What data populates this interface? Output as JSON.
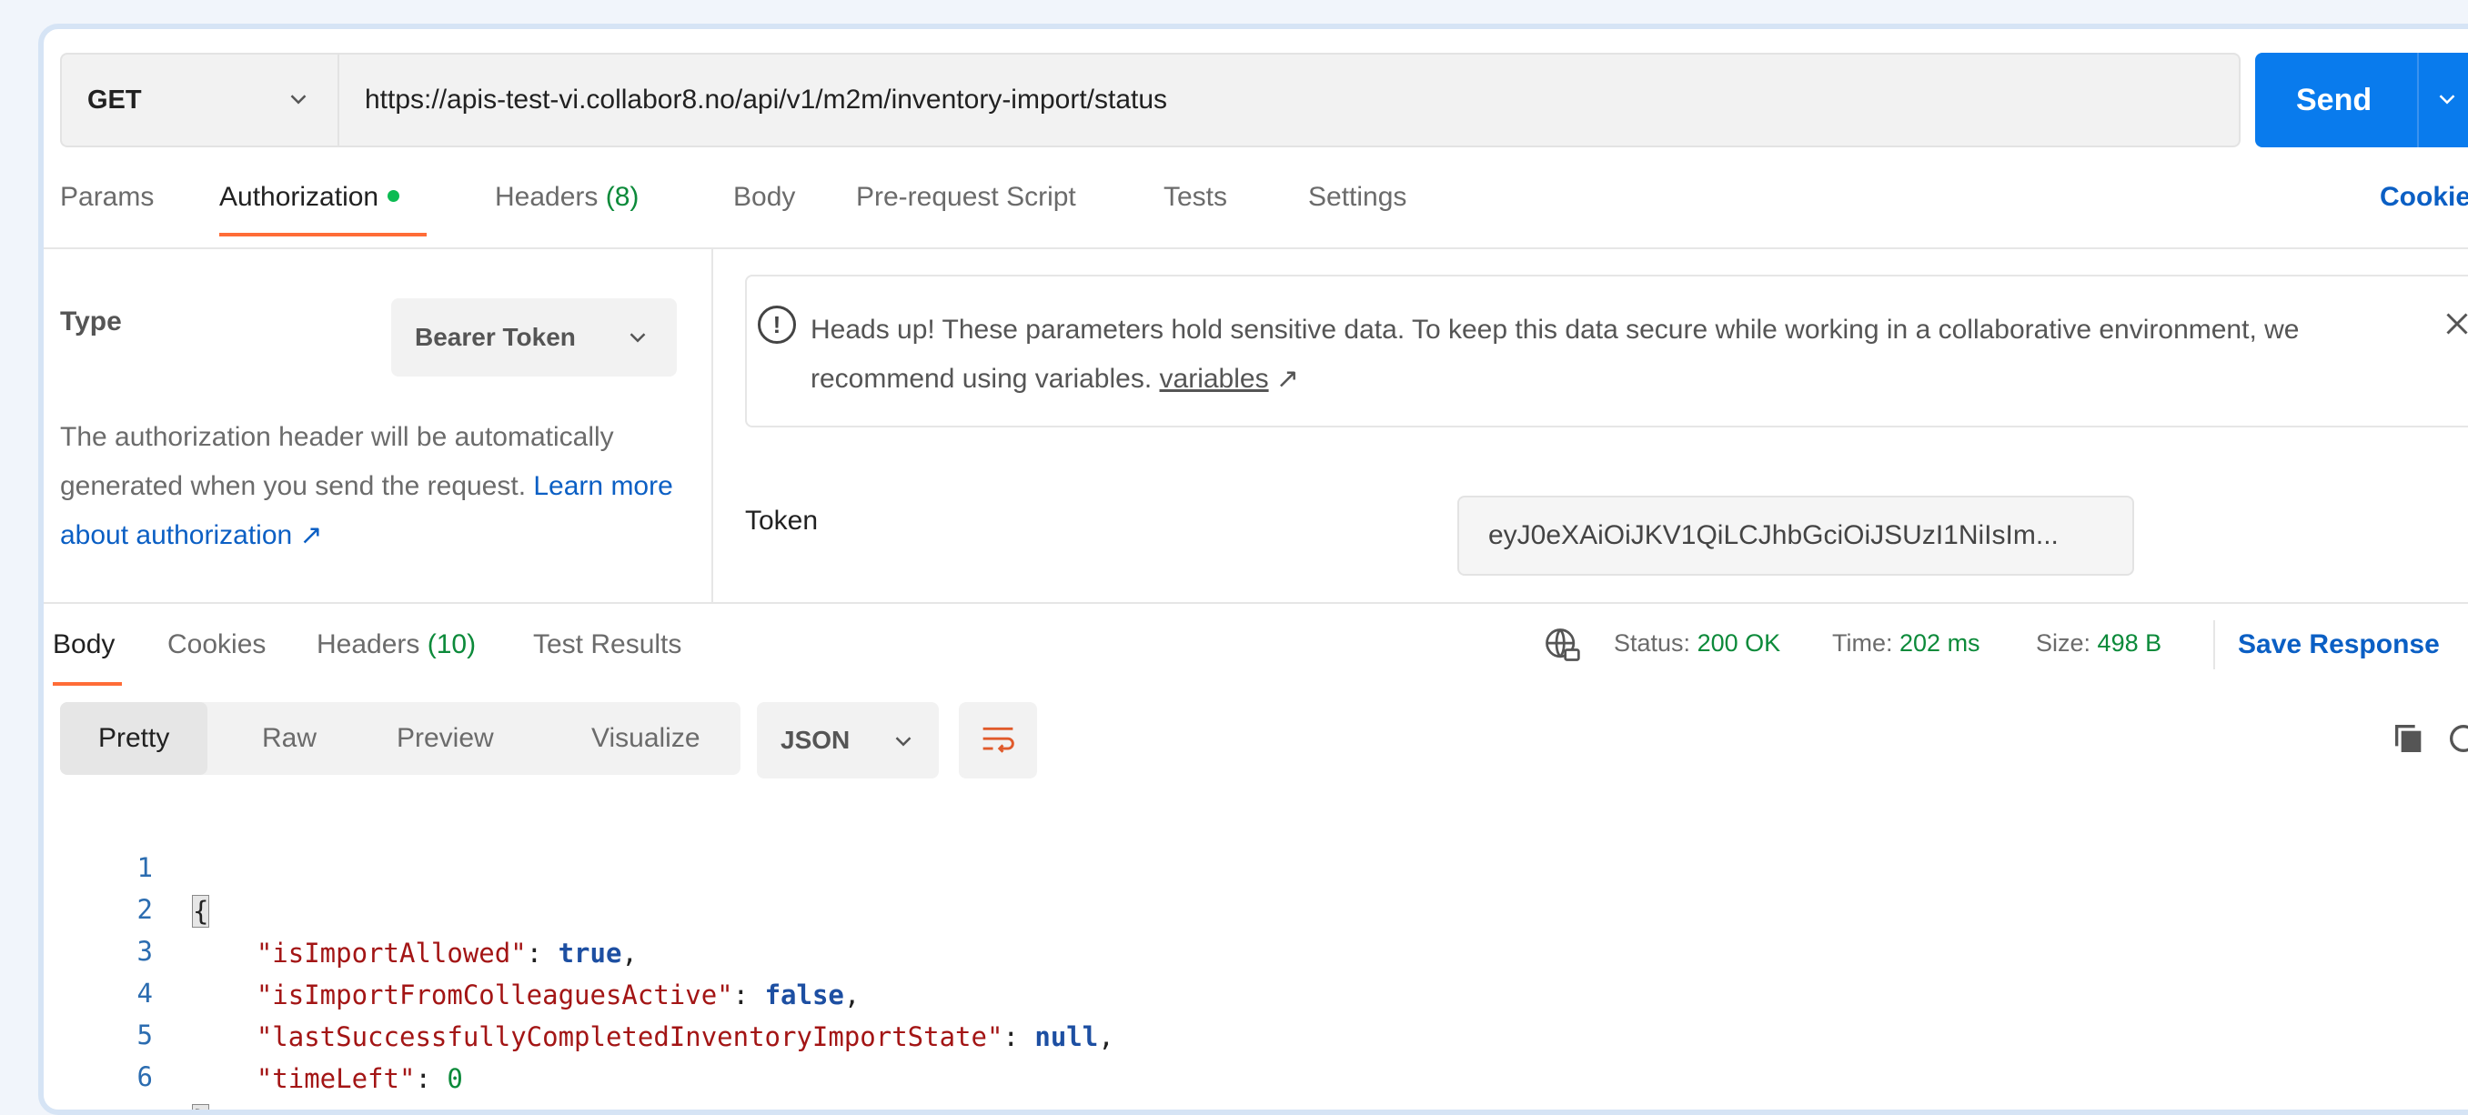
{
  "request": {
    "method": "GET",
    "url": "https://apis-test-vi.collabor8.no/api/v1/m2m/inventory-import/status",
    "send_label": "Send"
  },
  "tabs": {
    "params": "Params",
    "authorization": "Authorization",
    "headers": "Headers",
    "headers_count": "(8)",
    "body": "Body",
    "pre_request": "Pre-request Script",
    "tests": "Tests",
    "settings": "Settings",
    "cookies": "Cookie"
  },
  "auth": {
    "type_label": "Type",
    "type_value": "Bearer Token",
    "desc_text": "The authorization header will be automatically generated when you send the request. ",
    "desc_link": "Learn more about authorization ↗",
    "alert_text": "Heads up! These parameters hold sensitive data. To keep this data secure while working in a collaborative environment, we recommend using variables. ",
    "alert_link": "variables",
    "alert_arrow": "↗",
    "token_label": "Token",
    "token_value": "eyJ0eXAiOiJKV1QiLCJhbGciOiJSUzI1NiIsIm",
    "token_ellipsis": "..."
  },
  "response": {
    "tabs": {
      "body": "Body",
      "cookies": "Cookies",
      "headers": "Headers",
      "headers_count": "(10)",
      "test_results": "Test Results"
    },
    "status_label": "Status:",
    "status_value": "200 OK",
    "time_label": "Time:",
    "time_value": "202 ms",
    "size_label": "Size:",
    "size_value": "498 B",
    "save_label": "Save Response",
    "view_modes": [
      "Pretty",
      "Raw",
      "Preview",
      "Visualize"
    ],
    "format": "JSON",
    "code": {
      "l1": "{",
      "k2": "\"isImportAllowed\"",
      "v2": "true",
      "k3": "\"isImportFromColleaguesActive\"",
      "v3": "false",
      "k4": "\"lastSuccessfullyCompletedInventoryImportState\"",
      "v4": "null",
      "k5": "\"timeLeft\"",
      "v5": "0",
      "l6": "}"
    },
    "line_numbers": [
      "1",
      "2",
      "3",
      "4",
      "5",
      "6"
    ]
  },
  "colors": {
    "accent": "#097bed",
    "tab_underline": "#ff6c37",
    "status_green": "#0c8a3a"
  }
}
